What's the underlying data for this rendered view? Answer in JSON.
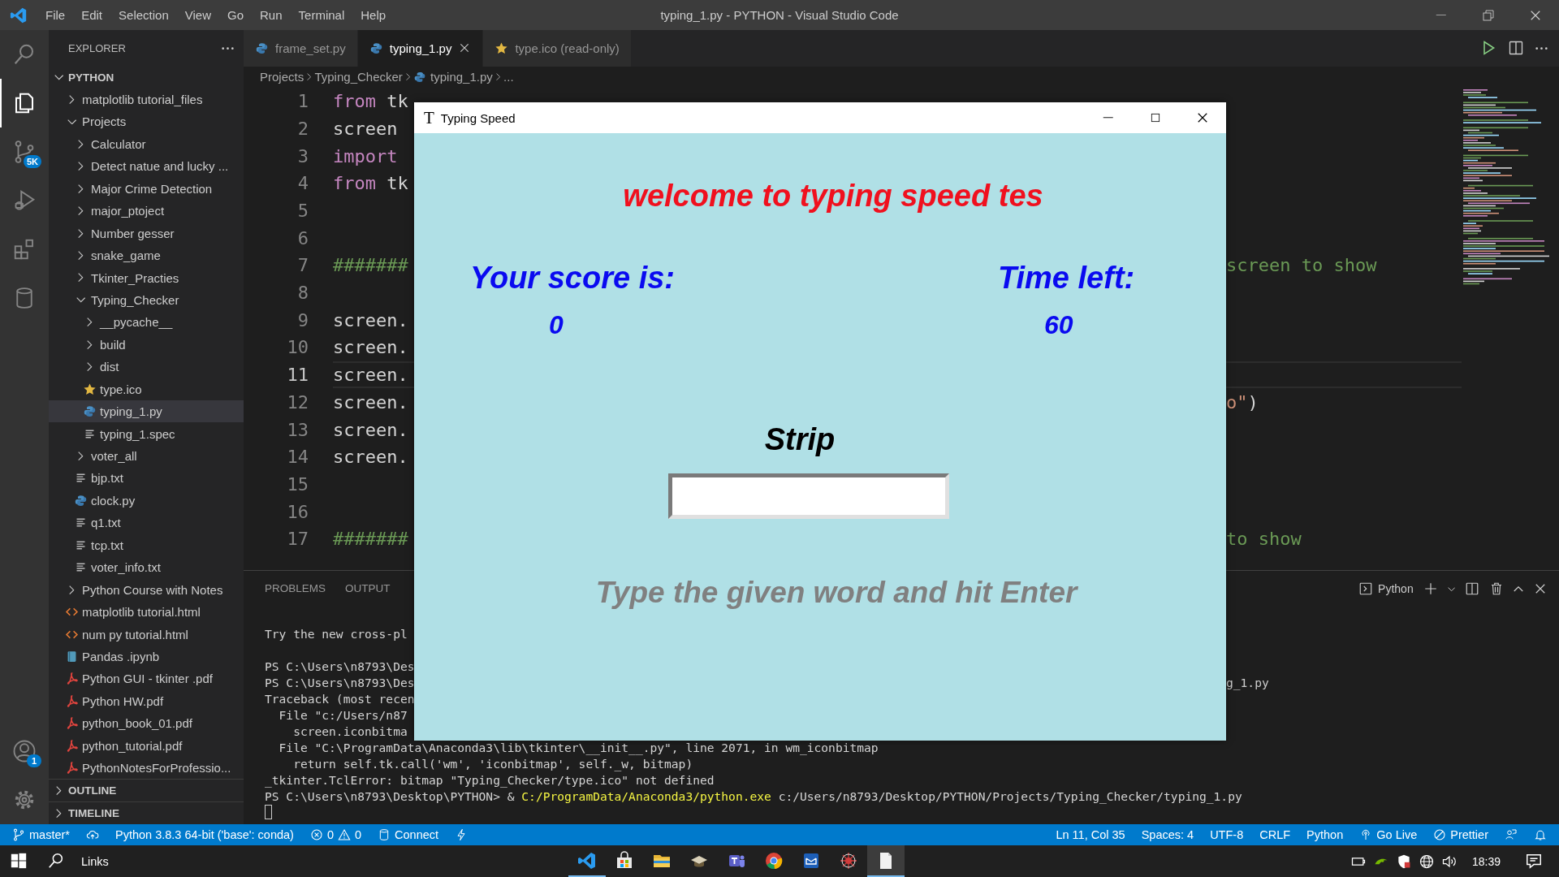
{
  "window": {
    "title": "typing_1.py - PYTHON - Visual Studio Code"
  },
  "menu": [
    "File",
    "Edit",
    "Selection",
    "View",
    "Go",
    "Run",
    "Terminal",
    "Help"
  ],
  "activity_bar": {
    "items": [
      {
        "kind": "search",
        "selected": false
      },
      {
        "kind": "explorer",
        "selected": true
      },
      {
        "kind": "source-control",
        "selected": false,
        "badge": "5K"
      },
      {
        "kind": "run",
        "selected": false
      },
      {
        "kind": "extensions",
        "selected": false
      },
      {
        "kind": "database",
        "selected": false
      }
    ],
    "bottom": [
      {
        "kind": "account",
        "badge": "1"
      },
      {
        "kind": "settings"
      }
    ]
  },
  "sidebar": {
    "title": "EXPLORER",
    "root": {
      "label": "PYTHON",
      "expanded": true
    },
    "tree": [
      {
        "label": "matplotlib tutorial_files",
        "kind": "folder",
        "expanded": false,
        "selected": false
      },
      {
        "label": "Projects",
        "kind": "folder",
        "expanded": true,
        "selected": false,
        "children": [
          {
            "label": "Calculator",
            "kind": "folder",
            "expanded": false,
            "selected": false
          },
          {
            "label": "Detect natue and lucky ...",
            "kind": "folder",
            "expanded": false,
            "selected": false
          },
          {
            "label": "Major Crime Detection",
            "kind": "folder",
            "expanded": false,
            "selected": false
          },
          {
            "label": "major_ptoject",
            "kind": "folder",
            "expanded": false,
            "selected": false
          },
          {
            "label": "Number gesser",
            "kind": "folder",
            "expanded": false,
            "selected": false
          },
          {
            "label": "snake_game",
            "kind": "folder",
            "expanded": false,
            "selected": false
          },
          {
            "label": "Tkinter_Practies",
            "kind": "folder",
            "expanded": false,
            "selected": false
          },
          {
            "label": "Typing_Checker",
            "kind": "folder",
            "expanded": true,
            "selected": false,
            "children": [
              {
                "label": "__pycache__",
                "kind": "folder",
                "expanded": false,
                "selected": false
              },
              {
                "label": "build",
                "kind": "folder",
                "expanded": false,
                "selected": false
              },
              {
                "label": "dist",
                "kind": "folder",
                "expanded": false,
                "selected": false
              },
              {
                "label": "type.ico",
                "kind": "image",
                "selected": false
              },
              {
                "label": "typing_1.py",
                "kind": "python",
                "selected": true
              },
              {
                "label": "typing_1.spec",
                "kind": "text",
                "selected": false
              }
            ]
          },
          {
            "label": "voter_all",
            "kind": "folder",
            "expanded": false,
            "selected": false
          },
          {
            "label": "bjp.txt",
            "kind": "text",
            "selected": false
          },
          {
            "label": "clock.py",
            "kind": "python",
            "selected": false
          },
          {
            "label": "q1.txt",
            "kind": "text",
            "selected": false
          },
          {
            "label": "tcp.txt",
            "kind": "text",
            "selected": false
          },
          {
            "label": "voter_info.txt",
            "kind": "text",
            "selected": false
          }
        ]
      },
      {
        "label": "Python Course with Notes",
        "kind": "folder",
        "expanded": false,
        "selected": false
      },
      {
        "label": "matplotlib tutorial.html",
        "kind": "html",
        "selected": false
      },
      {
        "label": "num py tutorial.html",
        "kind": "html",
        "selected": false
      },
      {
        "label": "Pandas .ipynb",
        "kind": "notebook",
        "selected": false
      },
      {
        "label": "Python GUI - tkinter .pdf",
        "kind": "pdf",
        "selected": false
      },
      {
        "label": "Python HW.pdf",
        "kind": "pdf",
        "selected": false
      },
      {
        "label": "python_book_01.pdf",
        "kind": "pdf",
        "selected": false
      },
      {
        "label": "python_tutorial.pdf",
        "kind": "pdf",
        "selected": false
      },
      {
        "label": "PythonNotesForProfessio...",
        "kind": "pdf",
        "selected": false
      }
    ],
    "sections": [
      {
        "label": "OUTLINE",
        "expanded": false
      },
      {
        "label": "TIMELINE",
        "expanded": false
      }
    ]
  },
  "tabs": [
    {
      "label": "frame_set.py",
      "kind": "python",
      "selected": false
    },
    {
      "label": "typing_1.py",
      "kind": "python",
      "selected": true
    },
    {
      "label": "type.ico (read-only)",
      "kind": "image",
      "selected": false
    }
  ],
  "breadcrumb": [
    {
      "label": "Projects"
    },
    {
      "label": "Typing_Checker"
    },
    {
      "label": "typing_1.py",
      "kind": "python"
    },
    {
      "label": "..."
    }
  ],
  "editor": {
    "lines": [
      {
        "number": "1",
        "current": false,
        "tokens": [
          {
            "text": "from",
            "kind": "keyword"
          },
          {
            "text": " tk",
            "kind": "plain"
          }
        ]
      },
      {
        "number": "2",
        "current": false,
        "tokens": [
          {
            "text": "screen",
            "kind": "plain"
          }
        ]
      },
      {
        "number": "3",
        "current": false,
        "tokens": [
          {
            "text": "import",
            "kind": "keyword"
          }
        ]
      },
      {
        "number": "4",
        "current": false,
        "tokens": [
          {
            "text": "from",
            "kind": "keyword"
          },
          {
            "text": " tk",
            "kind": "plain"
          }
        ]
      },
      {
        "number": "5",
        "current": false
      },
      {
        "number": "6",
        "current": false
      },
      {
        "number": "7",
        "current": false,
        "tokens": [
          {
            "text": "#######",
            "kind": "comment"
          }
        ],
        "right": [
          {
            "text": "screen to show",
            "kind": "comment"
          }
        ]
      },
      {
        "number": "8",
        "current": false
      },
      {
        "number": "9",
        "current": false,
        "tokens": [
          {
            "text": "screen.",
            "kind": "plain"
          }
        ]
      },
      {
        "number": "10",
        "current": false,
        "tokens": [
          {
            "text": "screen.",
            "kind": "plain"
          }
        ]
      },
      {
        "number": "11",
        "current": true,
        "tokens": [
          {
            "text": "screen.",
            "kind": "plain"
          }
        ]
      },
      {
        "number": "12",
        "current": false,
        "tokens": [
          {
            "text": "screen.",
            "kind": "plain"
          }
        ],
        "right": [
          {
            "text": "o\"",
            "kind": "string"
          },
          {
            "text": ")",
            "kind": "plain"
          }
        ]
      },
      {
        "number": "13",
        "current": false,
        "tokens": [
          {
            "text": "screen.",
            "kind": "plain"
          }
        ]
      },
      {
        "number": "14",
        "current": false,
        "tokens": [
          {
            "text": "screen.",
            "kind": "plain"
          }
        ]
      },
      {
        "number": "15",
        "current": false
      },
      {
        "number": "16",
        "current": false
      },
      {
        "number": "17",
        "current": false,
        "tokens": [
          {
            "text": "#######",
            "kind": "comment"
          }
        ],
        "right": [
          {
            "text": "to show",
            "kind": "comment"
          }
        ]
      }
    ]
  },
  "panel": {
    "tabs": [
      {
        "label": "PROBLEMS",
        "selected": false
      },
      {
        "label": "OUTPUT",
        "selected": false
      }
    ],
    "terminal_label": "Python",
    "blocks": [
      {
        "lines": [
          {
            "tokens": [
              {
                "text": "Try the new cross-pl",
                "kind": "plain"
              }
            ]
          }
        ]
      },
      {
        "lines": [
          {
            "tokens": [
              {
                "text": "PS C:\\Users\\n8793\\Des",
                "kind": "plain"
              }
            ]
          },
          {
            "tokens": [
              {
                "text": "PS C:\\Users\\n8793\\Des",
                "kind": "plain"
              }
            ],
            "right": "g_1.py"
          },
          {
            "tokens": [
              {
                "text": "Traceback (most recen",
                "kind": "plain"
              }
            ]
          },
          {
            "tokens": [
              {
                "text": "  File \"c:/Users/n87",
                "kind": "plain"
              }
            ]
          },
          {
            "tokens": [
              {
                "text": "    screen.iconbitma",
                "kind": "plain"
              }
            ]
          },
          {
            "tokens": [
              {
                "text": "  File \"C:\\ProgramData\\Anaconda3\\lib\\tkinter\\__init__.py\", line 2071, in wm_iconbitmap",
                "kind": "plain"
              }
            ]
          },
          {
            "tokens": [
              {
                "text": "    return self.tk.call('wm', 'iconbitmap', self._w, bitmap)",
                "kind": "plain"
              }
            ]
          },
          {
            "tokens": [
              {
                "text": "_tkinter.TclError: bitmap \"Typing_Checker/type.ico\" not defined",
                "kind": "plain"
              }
            ]
          },
          {
            "tokens": [
              {
                "text": "PS C:\\Users\\n8793\\Desktop\\PYTHON> & ",
                "kind": "plain"
              },
              {
                "text": "C:/ProgramData/Anaconda3/python.exe",
                "kind": "command"
              },
              {
                "text": " c:/Users/n8793/Desktop/PYTHON/Projects/Typing_Checker/typing_1.py",
                "kind": "plain"
              }
            ]
          }
        ]
      }
    ],
    "cursor": true
  },
  "dialog": {
    "icon": "T",
    "title": "Typing Speed",
    "heading": "welcome to typing speed tes",
    "score_label": "Your score is:",
    "score": "0",
    "time_label": "Time left:",
    "time": "60",
    "word": "Strip",
    "instruction": "Type the given word and hit Enter"
  },
  "status_bar": {
    "left": [
      {
        "kind": "branch",
        "text": "master*"
      },
      {
        "kind": "sync"
      },
      {
        "kind": "plain",
        "text": "Python 3.8.3 64-bit ('base': conda)"
      },
      {
        "kind": "problems",
        "errors": "0",
        "warnings": "0"
      },
      {
        "kind": "database",
        "text": "Connect"
      },
      {
        "kind": "bolt"
      }
    ],
    "right": [
      {
        "kind": "plain",
        "text": "Ln 11, Col 35"
      },
      {
        "kind": "plain",
        "text": "Spaces: 4"
      },
      {
        "kind": "plain",
        "text": "UTF-8"
      },
      {
        "kind": "plain",
        "text": "CRLF"
      },
      {
        "kind": "plain",
        "text": "Python"
      },
      {
        "kind": "broadcast",
        "text": "Go Live"
      },
      {
        "kind": "blocked",
        "text": "Prettier"
      },
      {
        "kind": "feedback"
      },
      {
        "kind": "bell"
      }
    ]
  },
  "taskbar": {
    "search_label": "Links",
    "apps": [
      {
        "kind": "code",
        "running": true,
        "selected": false
      },
      {
        "kind": "store",
        "running": false,
        "selected": false
      },
      {
        "kind": "folder",
        "running": false,
        "selected": false
      },
      {
        "kind": "hat",
        "running": false,
        "selected": false
      },
      {
        "kind": "teams",
        "running": false,
        "selected": false
      },
      {
        "kind": "browser",
        "running": false,
        "selected": false
      },
      {
        "kind": "mail",
        "running": false,
        "selected": false
      },
      {
        "kind": "bug",
        "running": false,
        "selected": false
      },
      {
        "kind": "notes",
        "running": true,
        "selected": true
      }
    ],
    "tray": [
      {
        "kind": "device"
      },
      {
        "kind": "gpu"
      },
      {
        "kind": "shield"
      },
      {
        "kind": "globe"
      },
      {
        "kind": "speaker"
      }
    ],
    "time": "18:39"
  }
}
